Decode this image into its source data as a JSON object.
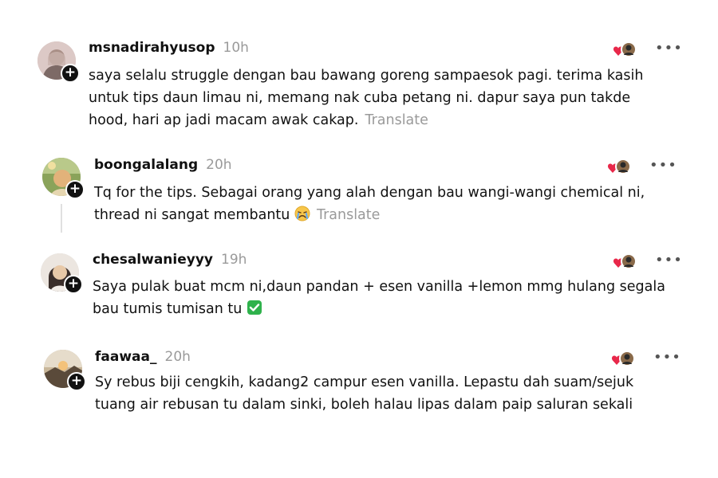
{
  "comments": [
    {
      "username": "msnadirahyusop",
      "time": "10h",
      "text_lines": [
        "saya selalu struggle dengan bau bawang goreng sampaesok pagi. terima kasih",
        "untuk tips daun limau ni, memang nak cuba petang ni. dapur saya pun takde",
        "hood, hari ap jadi macam awak cakap."
      ],
      "translate": "Translate",
      "plus": "+",
      "more": "•••"
    },
    {
      "username": "boongalalang",
      "time": "20h",
      "text_lines": [
        "Tq for the tips. Sebagai orang yang alah dengan bau wangi-wangi chemical ni,",
        "thread ni sangat membantu"
      ],
      "emoji": "crying-face",
      "translate": "Translate",
      "plus": "+",
      "more": "•••"
    },
    {
      "username": "chesalwanieyyy",
      "time": "19h",
      "text_lines": [
        "Saya pulak buat mcm ni,daun pandan + esen vanilla +lemon mmg hulang segala",
        "bau tumis tumisan tu"
      ],
      "emoji": "check-mark-button",
      "plus": "+",
      "more": "•••"
    },
    {
      "username": "faawaa_",
      "time": "20h",
      "text_lines": [
        "Sy rebus biji cengkih, kadang2 campur esen vanilla. Lepastu dah suam/sejuk",
        "tuang air rebusan tu dalam sinki, boleh halau lipas dalam paip saluran sekali"
      ],
      "plus": "+",
      "more": "•••"
    }
  ],
  "colors": {
    "heart": "#e8284a",
    "muted": "#9a9a9a",
    "check": "#2fb24c"
  }
}
